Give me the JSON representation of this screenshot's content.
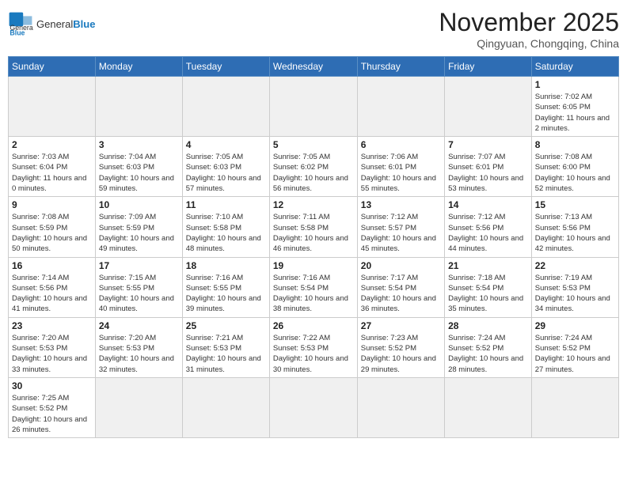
{
  "header": {
    "logo_general": "General",
    "logo_blue": "Blue",
    "month_title": "November 2025",
    "location": "Qingyuan, Chongqing, China"
  },
  "days_of_week": [
    "Sunday",
    "Monday",
    "Tuesday",
    "Wednesday",
    "Thursday",
    "Friday",
    "Saturday"
  ],
  "weeks": [
    [
      {
        "day": "",
        "info": ""
      },
      {
        "day": "",
        "info": ""
      },
      {
        "day": "",
        "info": ""
      },
      {
        "day": "",
        "info": ""
      },
      {
        "day": "",
        "info": ""
      },
      {
        "day": "",
        "info": ""
      },
      {
        "day": "1",
        "info": "Sunrise: 7:02 AM\nSunset: 6:05 PM\nDaylight: 11 hours and 2 minutes."
      }
    ],
    [
      {
        "day": "2",
        "info": "Sunrise: 7:03 AM\nSunset: 6:04 PM\nDaylight: 11 hours and 0 minutes."
      },
      {
        "day": "3",
        "info": "Sunrise: 7:04 AM\nSunset: 6:03 PM\nDaylight: 10 hours and 59 minutes."
      },
      {
        "day": "4",
        "info": "Sunrise: 7:05 AM\nSunset: 6:03 PM\nDaylight: 10 hours and 57 minutes."
      },
      {
        "day": "5",
        "info": "Sunrise: 7:05 AM\nSunset: 6:02 PM\nDaylight: 10 hours and 56 minutes."
      },
      {
        "day": "6",
        "info": "Sunrise: 7:06 AM\nSunset: 6:01 PM\nDaylight: 10 hours and 55 minutes."
      },
      {
        "day": "7",
        "info": "Sunrise: 7:07 AM\nSunset: 6:01 PM\nDaylight: 10 hours and 53 minutes."
      },
      {
        "day": "8",
        "info": "Sunrise: 7:08 AM\nSunset: 6:00 PM\nDaylight: 10 hours and 52 minutes."
      }
    ],
    [
      {
        "day": "9",
        "info": "Sunrise: 7:08 AM\nSunset: 5:59 PM\nDaylight: 10 hours and 50 minutes."
      },
      {
        "day": "10",
        "info": "Sunrise: 7:09 AM\nSunset: 5:59 PM\nDaylight: 10 hours and 49 minutes."
      },
      {
        "day": "11",
        "info": "Sunrise: 7:10 AM\nSunset: 5:58 PM\nDaylight: 10 hours and 48 minutes."
      },
      {
        "day": "12",
        "info": "Sunrise: 7:11 AM\nSunset: 5:58 PM\nDaylight: 10 hours and 46 minutes."
      },
      {
        "day": "13",
        "info": "Sunrise: 7:12 AM\nSunset: 5:57 PM\nDaylight: 10 hours and 45 minutes."
      },
      {
        "day": "14",
        "info": "Sunrise: 7:12 AM\nSunset: 5:56 PM\nDaylight: 10 hours and 44 minutes."
      },
      {
        "day": "15",
        "info": "Sunrise: 7:13 AM\nSunset: 5:56 PM\nDaylight: 10 hours and 42 minutes."
      }
    ],
    [
      {
        "day": "16",
        "info": "Sunrise: 7:14 AM\nSunset: 5:56 PM\nDaylight: 10 hours and 41 minutes."
      },
      {
        "day": "17",
        "info": "Sunrise: 7:15 AM\nSunset: 5:55 PM\nDaylight: 10 hours and 40 minutes."
      },
      {
        "day": "18",
        "info": "Sunrise: 7:16 AM\nSunset: 5:55 PM\nDaylight: 10 hours and 39 minutes."
      },
      {
        "day": "19",
        "info": "Sunrise: 7:16 AM\nSunset: 5:54 PM\nDaylight: 10 hours and 38 minutes."
      },
      {
        "day": "20",
        "info": "Sunrise: 7:17 AM\nSunset: 5:54 PM\nDaylight: 10 hours and 36 minutes."
      },
      {
        "day": "21",
        "info": "Sunrise: 7:18 AM\nSunset: 5:54 PM\nDaylight: 10 hours and 35 minutes."
      },
      {
        "day": "22",
        "info": "Sunrise: 7:19 AM\nSunset: 5:53 PM\nDaylight: 10 hours and 34 minutes."
      }
    ],
    [
      {
        "day": "23",
        "info": "Sunrise: 7:20 AM\nSunset: 5:53 PM\nDaylight: 10 hours and 33 minutes."
      },
      {
        "day": "24",
        "info": "Sunrise: 7:20 AM\nSunset: 5:53 PM\nDaylight: 10 hours and 32 minutes."
      },
      {
        "day": "25",
        "info": "Sunrise: 7:21 AM\nSunset: 5:53 PM\nDaylight: 10 hours and 31 minutes."
      },
      {
        "day": "26",
        "info": "Sunrise: 7:22 AM\nSunset: 5:53 PM\nDaylight: 10 hours and 30 minutes."
      },
      {
        "day": "27",
        "info": "Sunrise: 7:23 AM\nSunset: 5:52 PM\nDaylight: 10 hours and 29 minutes."
      },
      {
        "day": "28",
        "info": "Sunrise: 7:24 AM\nSunset: 5:52 PM\nDaylight: 10 hours and 28 minutes."
      },
      {
        "day": "29",
        "info": "Sunrise: 7:24 AM\nSunset: 5:52 PM\nDaylight: 10 hours and 27 minutes."
      }
    ],
    [
      {
        "day": "30",
        "info": "Sunrise: 7:25 AM\nSunset: 5:52 PM\nDaylight: 10 hours and 26 minutes."
      },
      {
        "day": "",
        "info": ""
      },
      {
        "day": "",
        "info": ""
      },
      {
        "day": "",
        "info": ""
      },
      {
        "day": "",
        "info": ""
      },
      {
        "day": "",
        "info": ""
      },
      {
        "day": "",
        "info": ""
      }
    ]
  ]
}
